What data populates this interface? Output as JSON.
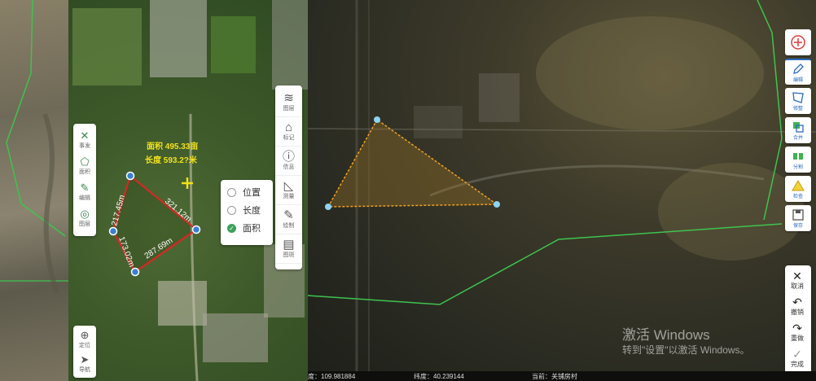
{
  "left_toolbar": [
    {
      "label": "事发",
      "icon": "close-icon",
      "glyph": "✕"
    },
    {
      "label": "面积",
      "icon": "polygon-icon",
      "glyph": "⬠"
    },
    {
      "label": "编辑",
      "icon": "edit-icon",
      "glyph": "✎"
    },
    {
      "label": "图层",
      "icon": "layers-icon",
      "glyph": "◎"
    }
  ],
  "bottom_left_toolbar": [
    {
      "label": "定位",
      "icon": "crosshair-icon",
      "glyph": "⊕"
    },
    {
      "label": "导航",
      "icon": "navigate-icon",
      "glyph": "➤"
    }
  ],
  "mid_toolbar": [
    {
      "label": "图层",
      "icon": "layers-icon",
      "glyph": "≋"
    },
    {
      "label": "标记",
      "icon": "tag-icon",
      "glyph": "⌂"
    },
    {
      "label": "信息",
      "icon": "info-icon",
      "glyph": "ⓘ"
    },
    {
      "label": "测量",
      "icon": "ruler-icon",
      "glyph": "◺"
    },
    {
      "label": "绘制",
      "icon": "pencil-icon",
      "glyph": "✎"
    },
    {
      "label": "图斑",
      "icon": "clipboard-icon",
      "glyph": "▤"
    }
  ],
  "measure_menu": {
    "items": [
      {
        "label": "位置",
        "selected": false
      },
      {
        "label": "长度",
        "selected": false
      },
      {
        "label": "面积",
        "selected": true
      }
    ]
  },
  "measurement": {
    "area_text": "面积 495.33亩",
    "length_text": "长度 593.2?米",
    "edges": [
      "321.12m",
      "217.45m",
      "173.02m",
      "287.69m"
    ]
  },
  "right_toolbar": [
    {
      "label": "",
      "icon": "add-circle-icon"
    },
    {
      "label": "编辑",
      "icon": "pencil-icon"
    },
    {
      "label": "修整",
      "icon": "polygon-edit-icon"
    },
    {
      "label": "合并",
      "icon": "merge-icon"
    },
    {
      "label": "分割",
      "icon": "split-icon"
    },
    {
      "label": "检查",
      "icon": "warning-icon"
    },
    {
      "label": "保存",
      "icon": "save-icon"
    }
  ],
  "action_panel": [
    {
      "label": "取消",
      "icon": "close-icon",
      "glyph": "✕"
    },
    {
      "label": "撤销",
      "icon": "undo-icon",
      "glyph": "↶"
    },
    {
      "label": "重做",
      "icon": "redo-icon",
      "glyph": "↷"
    },
    {
      "label": "完成",
      "icon": "check-icon",
      "glyph": "✓"
    }
  ],
  "status": {
    "longitude": "度：109.981884",
    "latitude": "纬度：40.239144",
    "location": "当前：关铺房村"
  },
  "watermark": {
    "title": "激活 Windows",
    "subtitle": "转到\"设置\"以激活 Windows。"
  },
  "colors": {
    "accent": "#2b6cc4",
    "measure_line": "#e02424",
    "polygon_line": "#f0a020",
    "vertex": "#8fd3f0",
    "boundary": "#3fc34f"
  }
}
